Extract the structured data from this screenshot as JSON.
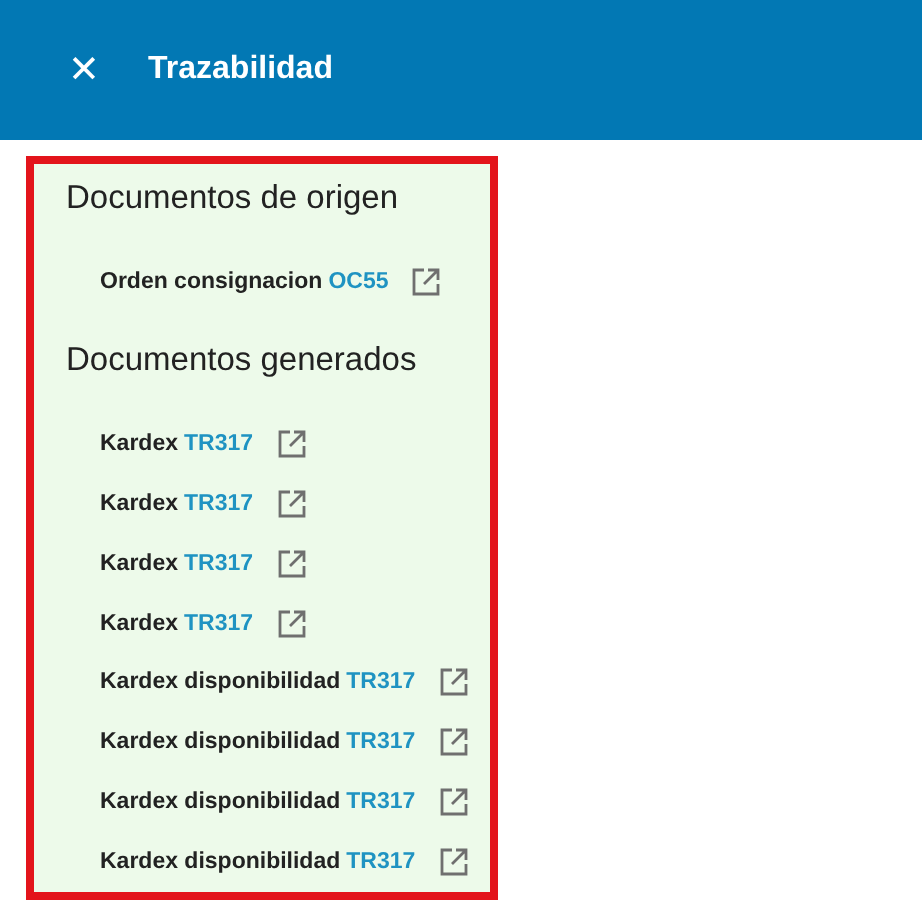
{
  "header": {
    "close_icon": "✕",
    "title": "Trazabilidad"
  },
  "sections": [
    {
      "title": "Documentos de origen",
      "items": [
        {
          "label": "Orden consignacion",
          "link": "OC55"
        }
      ]
    },
    {
      "title": "Documentos generados",
      "items": [
        {
          "label": "Kardex",
          "link": "TR317"
        },
        {
          "label": "Kardex",
          "link": "TR317"
        },
        {
          "label": "Kardex",
          "link": "TR317"
        },
        {
          "label": "Kardex",
          "link": "TR317"
        },
        {
          "label": "Kardex disponibilidad",
          "link": "TR317"
        },
        {
          "label": "Kardex disponibilidad",
          "link": "TR317"
        },
        {
          "label": "Kardex disponibilidad",
          "link": "TR317"
        },
        {
          "label": "Kardex disponibilidad",
          "link": "TR317"
        }
      ]
    }
  ]
}
